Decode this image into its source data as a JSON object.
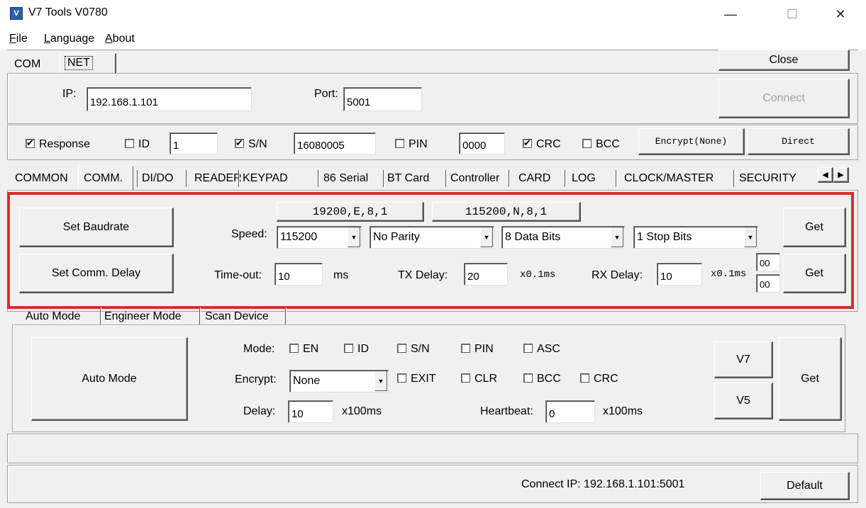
{
  "window": {
    "title": "V7 Tools V0780",
    "icon": "app-icon",
    "icon_glyph": "V",
    "controls": [
      "—",
      "☐",
      "✕"
    ]
  },
  "menu": [
    {
      "label": "File",
      "u": "F",
      "rest": "ile"
    },
    {
      "label": "Language",
      "u": "L",
      "rest": "anguage"
    },
    {
      "label": "About",
      "u": "A",
      "rest": "bout"
    }
  ],
  "conn_tabs": [
    "COM",
    "NET"
  ],
  "close_label": "Close",
  "net": {
    "ip_label": "IP:",
    "ip_value": "192.168.1.101",
    "port_label": "Port:",
    "port_value": "5001",
    "connect_label": "Connect"
  },
  "opts": {
    "response_label": "Response",
    "id_label": "ID",
    "id_value": "1",
    "sn_label": "S/N",
    "sn_value": "16080005",
    "pin_label": "PIN",
    "pin_value": "0000",
    "crc_label": "CRC",
    "bcc_label": "BCC",
    "encrypt_btn": "Encrypt(None)",
    "direct_btn": "Direct"
  },
  "main_tabs": [
    "COMMON",
    "COMM.",
    "DI/DO",
    "READER",
    "KEYPAD",
    "86 Serial",
    "BT Card",
    "Controller",
    "CARD",
    "LOG",
    "CLOCK/MASTER",
    "SECURITY"
  ],
  "comm": {
    "set_baud": "Set Baudrate",
    "set_delay": "Set Comm. Delay",
    "preset1": "19200,E,8,1",
    "preset2": "115200,N,8,1",
    "speed_label": "Speed:",
    "speed_value": "115200",
    "parity_value": "No Parity",
    "databits_value": "8 Data Bits",
    "stopbits_value": "1 Stop Bits",
    "get1": "Get",
    "timeout_label": "Time-out:",
    "timeout_value": "10",
    "ms_label": "ms",
    "tx_label": "TX Delay:",
    "tx_value": "20",
    "tx_unit": "x0.1ms",
    "rx_label": "RX Delay:",
    "rx_value": "10",
    "rx_unit": "x0.1ms",
    "small1": "00",
    "small2": "00",
    "get2": "Get"
  },
  "sub_tabs": [
    "Auto Mode",
    "Engineer Mode",
    "Scan Device"
  ],
  "auto": {
    "auto_btn": "Auto Mode",
    "mode_label": "Mode:",
    "en": "EN",
    "id": "ID",
    "sn": "S/N",
    "pin": "PIN",
    "asc": "ASC",
    "encrypt_label": "Encrypt:",
    "encrypt_value": "None",
    "exit": "EXIT",
    "clr": "CLR",
    "bcc": "BCC",
    "crc": "CRC",
    "delay_label": "Delay:",
    "delay_value": "10",
    "delay_unit": "x100ms",
    "heartbeat_label": "Heartbeat:",
    "heartbeat_value": "0",
    "heartbeat_unit": "x100ms",
    "v7": "V7",
    "v5": "V5",
    "get": "Get"
  },
  "status": {
    "connect_ip": "Connect IP: 192.168.1.101:5001",
    "default_btn": "Default"
  }
}
